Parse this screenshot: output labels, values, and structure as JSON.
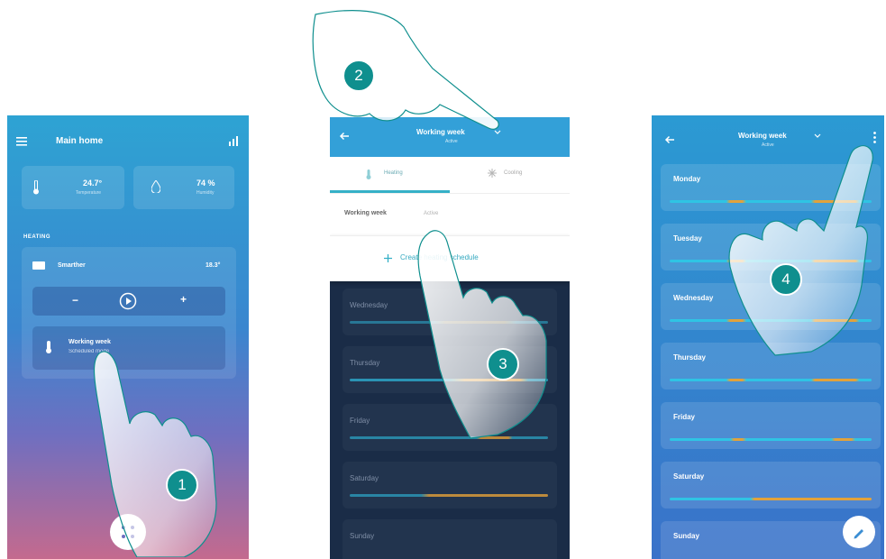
{
  "screen1": {
    "header_title": "Main home",
    "temperature": "24.7°",
    "temperature_caption": "Temperature",
    "humidity": "74 %",
    "humidity_caption": "Humidity",
    "section_label": "HEATING",
    "zone_name": "Smarther",
    "zone_temp": "18.3°",
    "minus_label": "−",
    "plus_label": "+",
    "schedule_name": "Working week",
    "schedule_sub": "Scheduled mode"
  },
  "screen2": {
    "header_title": "Working week",
    "header_sub": "Active",
    "tab_heating": "Heating",
    "tab_cooling": "Cooling",
    "schedule_row": "Working week",
    "schedule_row_sub": "Active",
    "create_label": "Create heating schedule",
    "days": [
      "Wednesday",
      "Thursday",
      "Friday",
      "Saturday",
      "Sunday"
    ]
  },
  "screen3": {
    "header_title": "Working week",
    "header_sub": "Active",
    "days": [
      "Monday",
      "Tuesday",
      "Wednesday",
      "Thursday",
      "Friday",
      "Saturday",
      "Sunday"
    ]
  },
  "steps": {
    "one": "1",
    "two": "2",
    "three": "3",
    "four": "4"
  },
  "colors": {
    "step_badge": "#0f8f8e",
    "header_blue": "#33a0d8",
    "bar_cyan": "#2fc4e4",
    "bar_orange": "#e2a23b",
    "dark_panel": "#1a2c47"
  },
  "icons": [
    "menu-icon",
    "chart-icon",
    "thermometer-icon",
    "droplet-icon",
    "radiator-icon",
    "play-icon",
    "mode-icon",
    "back-arrow-icon",
    "chevron-down-icon",
    "more-vert-icon",
    "plus-icon",
    "dots-grid-icon",
    "pencil-icon"
  ]
}
